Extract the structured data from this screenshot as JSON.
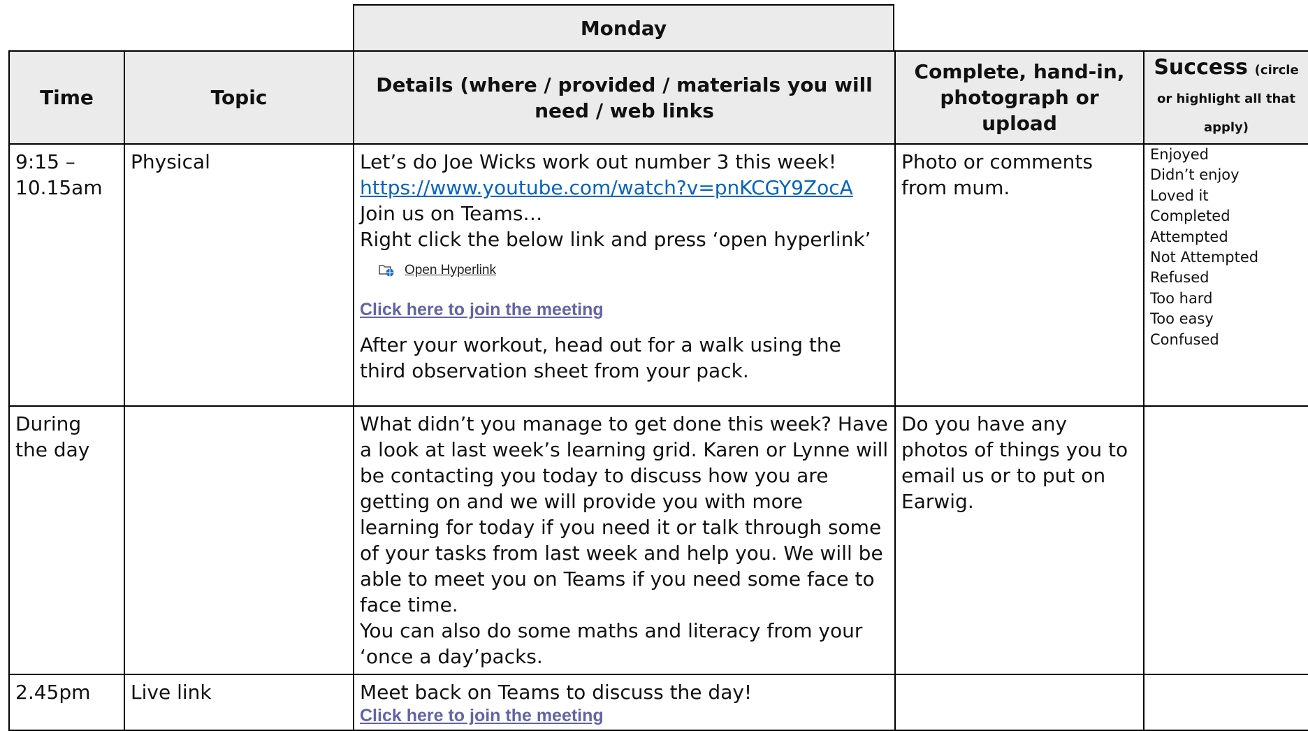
{
  "day": "Monday",
  "headers": {
    "time": "Time",
    "topic": "Topic",
    "details": "Details (where / provided / materials you will need / web links",
    "complete": "Complete, hand-in, photograph or upload",
    "success_main": "Success",
    "success_sub": "(circle or highlight all that apply)"
  },
  "rows": [
    {
      "time": "9:15 – 10.15am",
      "topic": "Physical",
      "details": {
        "line1": "Let’s do Joe Wicks work out number 3 this week!",
        "link": "https://www.youtube.com/watch?v=pnKCGY9ZocA",
        "line2": "Join us on Teams…",
        "line3": "Right click the below link and press ‘open hyperlink’",
        "open_hyperlink": "Open Hyperlink",
        "meeting_link": "Click here to join the meeting",
        "line4": "After your workout, head out for a walk using the third observation sheet from your pack."
      },
      "complete": "Photo or comments from mum.",
      "success_options": [
        "Enjoyed",
        "Didn’t enjoy",
        "Loved it",
        "Completed",
        "Attempted",
        "Not Attempted",
        "Refused",
        "Too hard",
        "Too easy",
        "Confused"
      ]
    },
    {
      "time": "During the day",
      "topic": "",
      "details": {
        "para1": "What didn’t you manage to get done this week? Have a look at last week’s learning grid. Karen or Lynne will be contacting you today to discuss how you are getting on and we will provide you with more learning for today if you need it or talk through some of your tasks from last week and help you. We will be able to meet you on Teams if you need some face to face time.",
        "para2": "You can also do some maths and literacy from your ‘once a day’packs."
      },
      "complete": "Do you have any photos of things you to email us or to put on Earwig."
    },
    {
      "time": "2.45pm",
      "topic": "Live link",
      "details": {
        "line1": "Meet back on Teams to discuss the day!",
        "meeting_link": "Click here to join the meeting"
      },
      "complete": ""
    }
  ]
}
